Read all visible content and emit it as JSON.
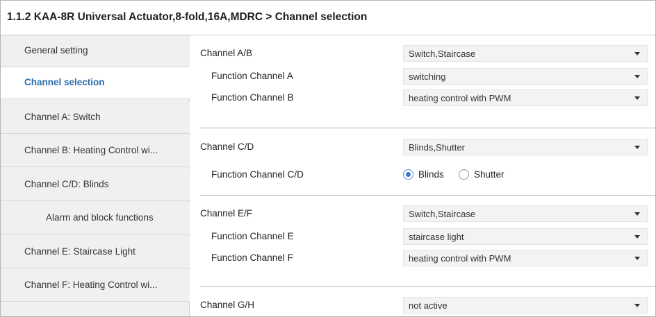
{
  "window": {
    "title": "1.1.2 KAA-8R Universal Actuator,8-fold,16A,MDRC > Channel selection"
  },
  "sidebar": {
    "items": [
      {
        "label": "General setting"
      },
      {
        "label": "Channel selection"
      },
      {
        "label": "Channel A: Switch"
      },
      {
        "label": "Channel B: Heating Control wi..."
      },
      {
        "label": "Channel C/D: Blinds"
      },
      {
        "label": "Alarm and block functions"
      },
      {
        "label": "Channel E: Staircase Light"
      },
      {
        "label": "Channel F: Heating Control wi..."
      }
    ],
    "active_index": 1
  },
  "content": {
    "ab": {
      "label": "Channel A/B",
      "value": "Switch,Staircase",
      "func_a": {
        "label": "Function Channel A",
        "value": "switching"
      },
      "func_b": {
        "label": "Function Channel B",
        "value": "heating control with PWM"
      }
    },
    "cd": {
      "label": "Channel C/D",
      "value": "Blinds,Shutter",
      "func_cd": {
        "label": "Function Channel C/D",
        "options": [
          "Blinds",
          "Shutter"
        ],
        "selected": "Blinds"
      }
    },
    "ef": {
      "label": "Channel E/F",
      "value": "Switch,Staircase",
      "func_e": {
        "label": "Function Channel E",
        "value": "staircase light"
      },
      "func_f": {
        "label": "Function Channel F",
        "value": "heating control with PWM"
      }
    },
    "gh": {
      "label": "Channel G/H",
      "value": "not active"
    }
  },
  "colors": {
    "active_nav_text": "#2b6cb0",
    "radio_accent": "#3a78c8"
  }
}
